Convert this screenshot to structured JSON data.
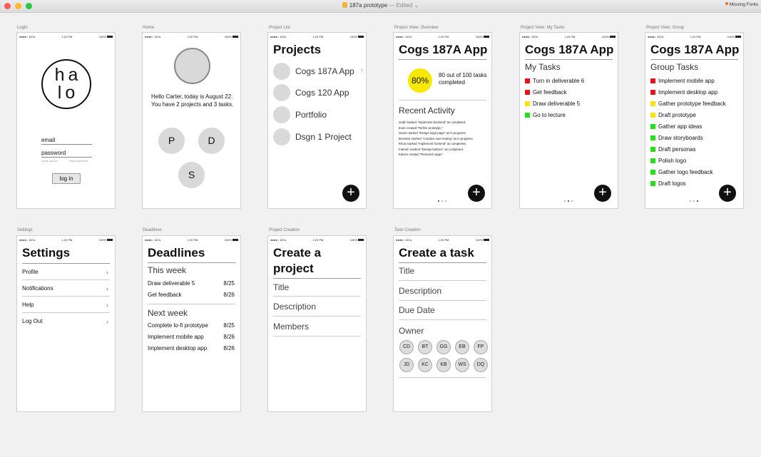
{
  "window": {
    "title": "187a prototype",
    "edited": "— Edited",
    "missing_fonts": "Missing Fonts"
  },
  "colors": {
    "red": "#e8121b",
    "yellow": "#f5e50a",
    "green": "#22e01a",
    "progress": "#f7e800"
  },
  "status": {
    "carrier": "●●●●○ 187a",
    "time": "1:20 PM",
    "battery": "100%"
  },
  "login": {
    "label": "Login",
    "logo_top": "ha",
    "logo_bottom": "lo",
    "email": "email",
    "password": "password",
    "create_account": "create account",
    "forgot_password": "forgot password?",
    "login_button": "log in"
  },
  "home": {
    "label": "Home",
    "greeting": "Hello Carter, today is August 22. You have 2 projects and 3 tasks.",
    "circles": [
      "P",
      "D",
      "S"
    ]
  },
  "project_list": {
    "label": "Project List",
    "title": "Projects",
    "items": [
      "Cogs 187A App",
      "Cogs 120 App",
      "Portfolio",
      "Dsgn 1 Project"
    ],
    "chevron": "›"
  },
  "overview": {
    "label": "Project View: Overview",
    "title": "Cogs 187A App",
    "progress_percent": "80%",
    "progress_fraction": 0.8,
    "progress_text": "80 out of 100 tasks completed",
    "recent_title": "Recent Activity",
    "activity": [
      "Judd marked \"Implement backend\" as completed.",
      "Evan created \"Refine prototype.\"",
      "Gavin marked \"Design login page\" as in progress.",
      "Brendon marked \"Conduct user testing\" as in progress.",
      "Khoa marked \"Implement frontend\" as completed.",
      "Fatmeh marked \"Design buttons\" as completed.",
      "Kaiven created \"Research apps.\""
    ]
  },
  "my_tasks": {
    "label": "Project View: My Tasks",
    "title": "Cogs 187A App",
    "subtitle": "My Tasks",
    "tasks": [
      {
        "name": "Turn in deliverable 6",
        "status": "red"
      },
      {
        "name": "Get feedback",
        "status": "red"
      },
      {
        "name": "Draw deliverable 5",
        "status": "yellow"
      },
      {
        "name": "Go to lecture",
        "status": "green"
      }
    ]
  },
  "group": {
    "label": "Project View: Group",
    "title": "Cogs 187A App",
    "subtitle": "Group Tasks",
    "tasks": [
      {
        "name": "Implement mobile app",
        "status": "red"
      },
      {
        "name": "Implement desktop app",
        "status": "red"
      },
      {
        "name": "Gather prototype feedback",
        "status": "yellow"
      },
      {
        "name": "Draft prototype",
        "status": "yellow"
      },
      {
        "name": "Gather app ideas",
        "status": "green"
      },
      {
        "name": "Draw storyboards",
        "status": "green"
      },
      {
        "name": "Draft personas",
        "status": "green"
      },
      {
        "name": "Polish logo",
        "status": "green"
      },
      {
        "name": "Gather logo feedback",
        "status": "green"
      },
      {
        "name": "Draft logos",
        "status": "green"
      }
    ]
  },
  "settings": {
    "label": "Settings",
    "title": "Settings",
    "items": [
      "Profile",
      "Notifications",
      "Help",
      "Log Out"
    ],
    "chevron": "›"
  },
  "deadlines": {
    "label": "Deadlines",
    "title": "Deadlines",
    "this_week": "This week",
    "this_week_items": [
      {
        "name": "Draw deliverable 5",
        "date": "8/25"
      },
      {
        "name": "Get feedback",
        "date": "8/26"
      }
    ],
    "next_week": "Next week",
    "next_week_items": [
      {
        "name": "Complete lo-fi prototype",
        "date": "8/25"
      },
      {
        "name": "Implement mobile app",
        "date": "8/26"
      },
      {
        "name": "Implement desktop app",
        "date": "8/26"
      }
    ]
  },
  "project_creation": {
    "label": "Project Creation",
    "title_line1": "Create a",
    "title_line2": "project",
    "fields": [
      "Title",
      "Description",
      "Members"
    ]
  },
  "task_creation": {
    "label": "Task Creation",
    "title": "Create a task",
    "fields": [
      "Title",
      "Description",
      "Due Date"
    ],
    "owner_label": "Owner",
    "owners": [
      "CD",
      "BT",
      "GG",
      "EB",
      "FP",
      "JD",
      "KC",
      "KB",
      "WS",
      "DQ"
    ]
  },
  "fab_symbol": "+"
}
